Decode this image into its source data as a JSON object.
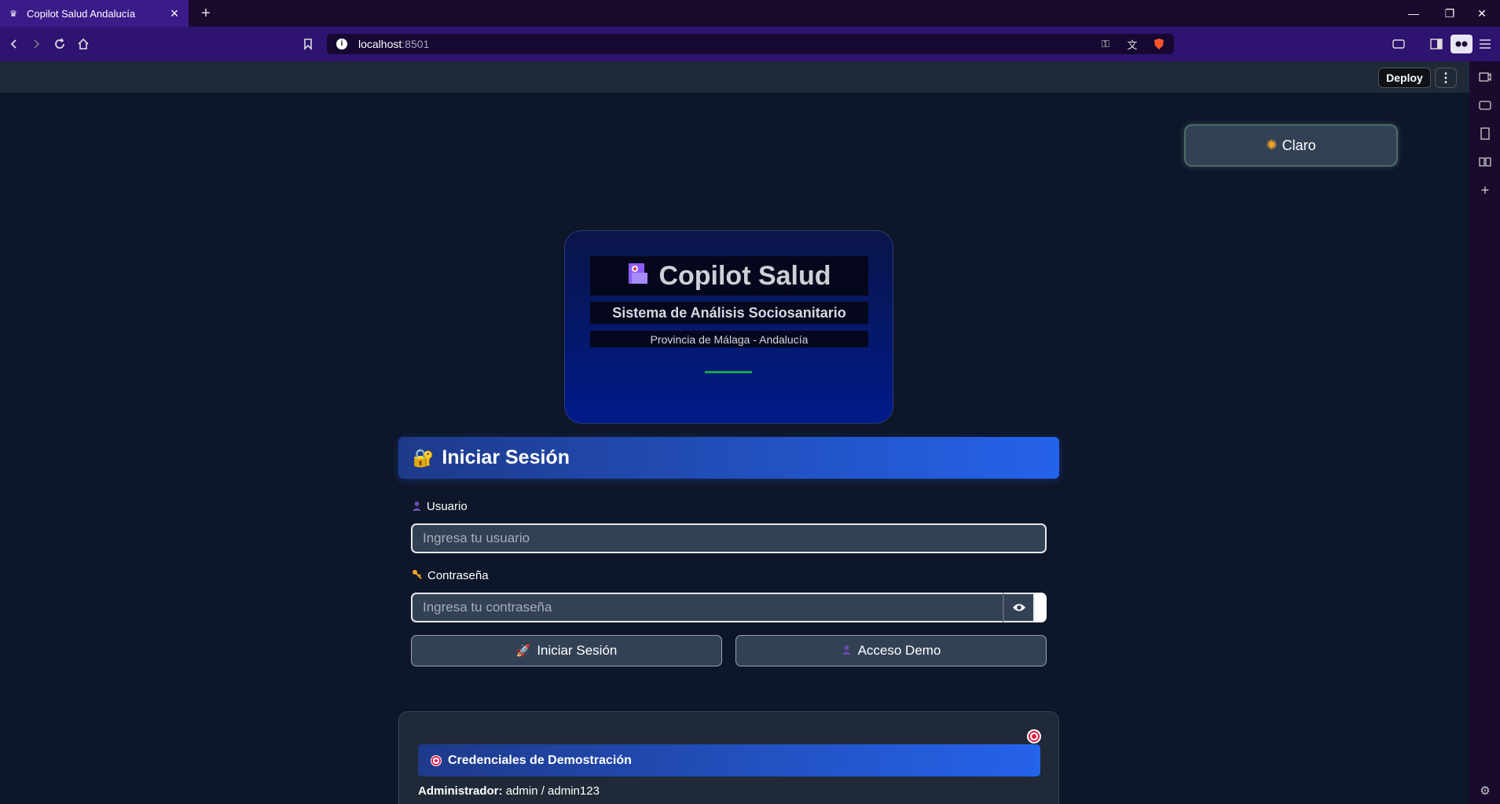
{
  "browser": {
    "tab_title": "Copilot Salud Andalucía",
    "url_host": "localhost",
    "url_port": ":8501"
  },
  "streamlit": {
    "deploy_label": "Deploy"
  },
  "theme_toggle": {
    "label": "Claro"
  },
  "hero": {
    "title": "Copilot Salud",
    "subtitle": "Sistema de Análisis Sociosanitario",
    "location": "Provincia de Málaga - Andalucía"
  },
  "login": {
    "header": "Iniciar Sesión",
    "user_label": "Usuario",
    "user_placeholder": "Ingresa tu usuario",
    "password_label": "Contraseña",
    "password_placeholder": "Ingresa tu contraseña",
    "login_button": "Iniciar Sesión",
    "demo_button": "Acceso Demo"
  },
  "credentials": {
    "header": "Credenciales de Demostración",
    "admin_role": "Administrador:",
    "admin_value": "admin / admin123"
  }
}
